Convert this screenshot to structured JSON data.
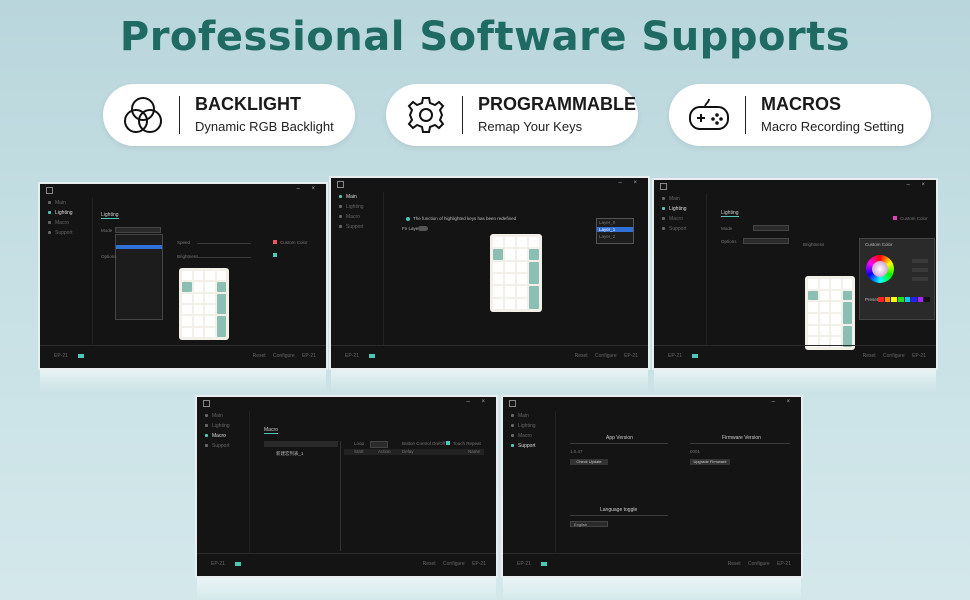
{
  "headline": "Professional Software Supports",
  "features": [
    {
      "icon": "rgb-circles-icon",
      "title": "BACKLIGHT",
      "subtitle": "Dynamic RGB Backlight"
    },
    {
      "icon": "gear-icon",
      "title": "PROGRAMMABLE",
      "subtitle": "Remap Your Keys"
    },
    {
      "icon": "gamepad-icon",
      "title": "MACROS",
      "subtitle": "Macro Recording Setting"
    }
  ],
  "sidebar": [
    "Main",
    "Lighting",
    "Macro",
    "Support"
  ],
  "footer": {
    "version": "EP-21",
    "actions": "Reset Configure EP-21"
  },
  "screens": {
    "main": {
      "notice": "The function of highlighted keys has been redefined",
      "fnlayer": "Fn Layer",
      "layer_select": "Layer_0",
      "layer_options": [
        "Layer_0",
        "Layer_1",
        "Layer_2"
      ]
    },
    "lighting": {
      "title": "Lighting",
      "mode": "Mode",
      "options": "Options",
      "speed": "Speed",
      "brightness": "Brightness",
      "custom_color": "Custom Color",
      "preset": "Preset"
    },
    "macro": {
      "title": "Macro",
      "item": "新建宏列表_1",
      "loop": "Loop",
      "button_ctrl": "Button Control On/Off",
      "touch_repeat": "Touch Repeat",
      "cols": [
        "Start",
        "Action",
        "Delay",
        "Name"
      ]
    },
    "support": {
      "app_version": "App Version",
      "app_ver_num": "1.0.47",
      "check_update": "Check Update",
      "fw_version": "Firmware Version",
      "fw_ver_num": "0001",
      "upgrade": "Upgrade Firmware",
      "lang": "Language toggle",
      "lang_value": "English"
    }
  },
  "colors": {
    "accent": "#1f6b64",
    "teal": "#4cc7b8",
    "key_green": "#8bbfb3"
  }
}
